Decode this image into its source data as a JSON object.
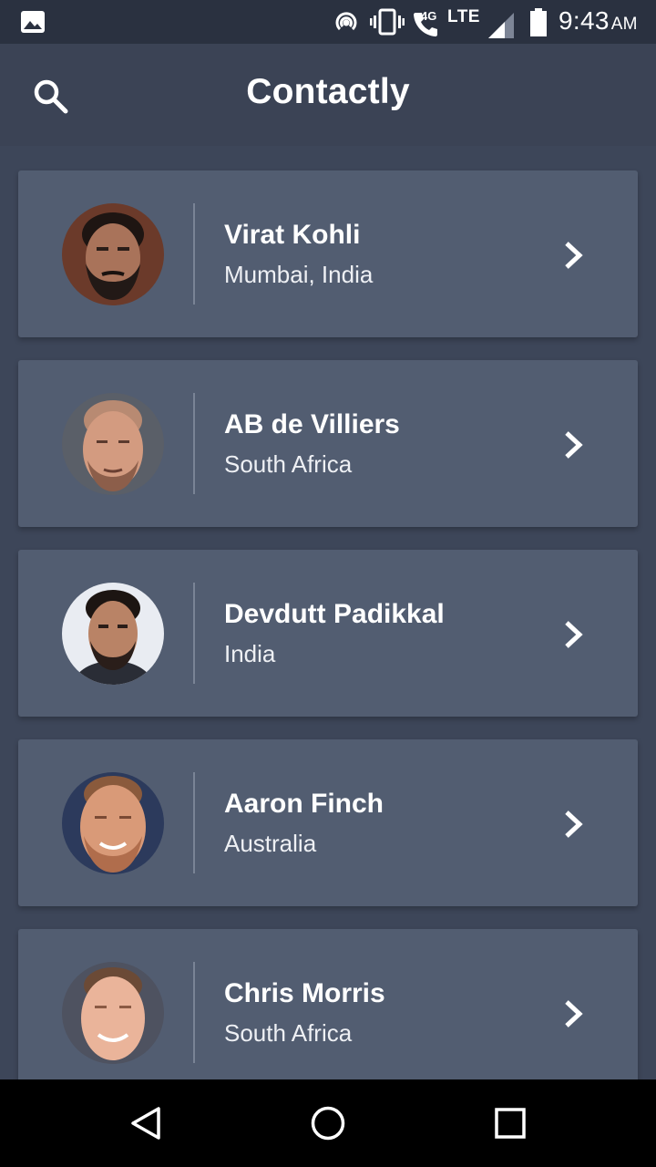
{
  "status_bar": {
    "network_small": "4G",
    "network": "LTE",
    "time": "9:43",
    "ampm": "AM",
    "icons": [
      "gallery-icon",
      "hotspot-icon",
      "vibrate-icon",
      "call-icon",
      "signal-icon",
      "battery-icon"
    ]
  },
  "app_bar": {
    "title": "Contactly",
    "search_icon": "search-icon"
  },
  "contacts": [
    {
      "name": "Virat Kohli",
      "location": "Mumbai, India"
    },
    {
      "name": "AB de Villiers",
      "location": "South Africa"
    },
    {
      "name": "Devdutt Padikkal",
      "location": "India"
    },
    {
      "name": "Aaron Finch",
      "location": "Australia"
    },
    {
      "name": "Chris Morris",
      "location": "South Africa"
    }
  ],
  "nav_bar": {
    "icons": [
      "back-icon",
      "home-icon",
      "recents-icon"
    ]
  },
  "colors": {
    "background": "#3d4659",
    "card": "#525d71",
    "status_bar": "#2a3140",
    "nav_bar": "#000000"
  }
}
